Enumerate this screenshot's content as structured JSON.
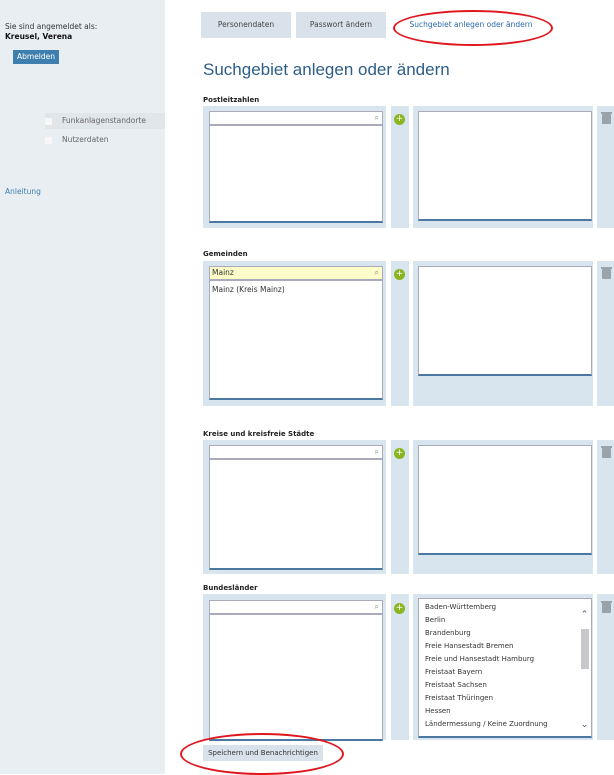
{
  "sidebar": {
    "logged_in_label": "Sie sind angemeldet als:",
    "user_name": "Kreusel, Verena",
    "logout_label": "Abmelden",
    "items": [
      {
        "label": "Funkanlagenstandorte"
      },
      {
        "label": "Nutzerdaten"
      }
    ],
    "help_label": "Anleitung"
  },
  "tabs": [
    {
      "label": "Personendaten"
    },
    {
      "label": "Passwort ändern"
    },
    {
      "label": "Suchgebiet anlegen oder ändern",
      "active": true
    }
  ],
  "page_title": "Suchgebiet anlegen oder ändern",
  "sections": {
    "postleitzahlen": {
      "label": "Postleitzahlen",
      "search_value": ""
    },
    "gemeinden": {
      "label": "Gemeinden",
      "search_value": "Mainz",
      "results": [
        "Mainz (Kreis Mainz)"
      ]
    },
    "kreise": {
      "label": "Kreise und kreisfreie Städte",
      "search_value": ""
    },
    "bundeslaender": {
      "label": "Bundesländer",
      "search_value": "",
      "available": [
        "Baden-Württemberg",
        "Berlin",
        "Brandenburg",
        "Freie Hansestadt Bremen",
        "Freie und Hansestadt Hamburg",
        "Freistaat Bayern",
        "Freistaat Sachsen",
        "Freistaat Thüringen",
        "Hessen",
        "Ländermessung / Keine Zuordnung"
      ]
    }
  },
  "save_label": "Speichern und Benachrichtigen",
  "icons": {
    "search": "search-icon",
    "add": "add-icon",
    "trash": "trash-icon"
  },
  "colors": {
    "accent": "#3f7fb0",
    "highlight_circle": "#e0161e",
    "add_button": "#8ab520"
  }
}
